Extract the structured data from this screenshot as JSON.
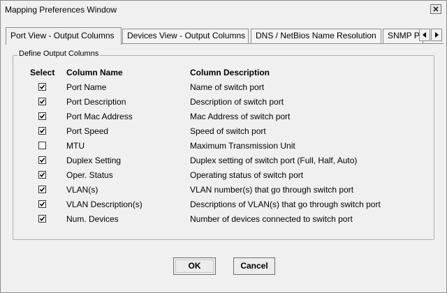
{
  "window": {
    "title": "Mapping Preferences Window"
  },
  "tabs": [
    {
      "label": "Port View - Output Columns",
      "active": true
    },
    {
      "label": "Devices View - Output Columns",
      "active": false
    },
    {
      "label": "DNS / NetBios Name Resolution",
      "active": false
    },
    {
      "label": "SNMP P",
      "active": false
    }
  ],
  "group": {
    "legend": "Define Output Columns"
  },
  "table": {
    "headers": {
      "select": "Select",
      "name": "Column Name",
      "description": "Column Description"
    },
    "rows": [
      {
        "checked": true,
        "name": "Port Name",
        "description": "Name of switch port"
      },
      {
        "checked": true,
        "name": "Port Description",
        "description": "Description of switch port"
      },
      {
        "checked": true,
        "name": "Port Mac Address",
        "description": "Mac Address of switch port"
      },
      {
        "checked": true,
        "name": "Port Speed",
        "description": "Speed of switch port"
      },
      {
        "checked": false,
        "name": "MTU",
        "description": "Maximum Transmission Unit"
      },
      {
        "checked": true,
        "name": "Duplex Setting",
        "description": "Duplex setting of switch port (Full, Half, Auto)"
      },
      {
        "checked": true,
        "name": "Oper. Status",
        "description": "Operating status of switch port"
      },
      {
        "checked": true,
        "name": "VLAN(s)",
        "description": "VLAN number(s) that go through switch port"
      },
      {
        "checked": true,
        "name": "VLAN Description(s)",
        "description": "Descriptions of VLAN(s) that go through switch port"
      },
      {
        "checked": true,
        "name": "Num. Devices",
        "description": "Number of devices connected to switch port"
      }
    ]
  },
  "buttons": {
    "ok": "OK",
    "cancel": "Cancel"
  },
  "icons": {
    "close": "close-icon",
    "tab_prev": "chevron-left-icon",
    "tab_next": "chevron-right-icon",
    "check": "checkmark-icon"
  }
}
